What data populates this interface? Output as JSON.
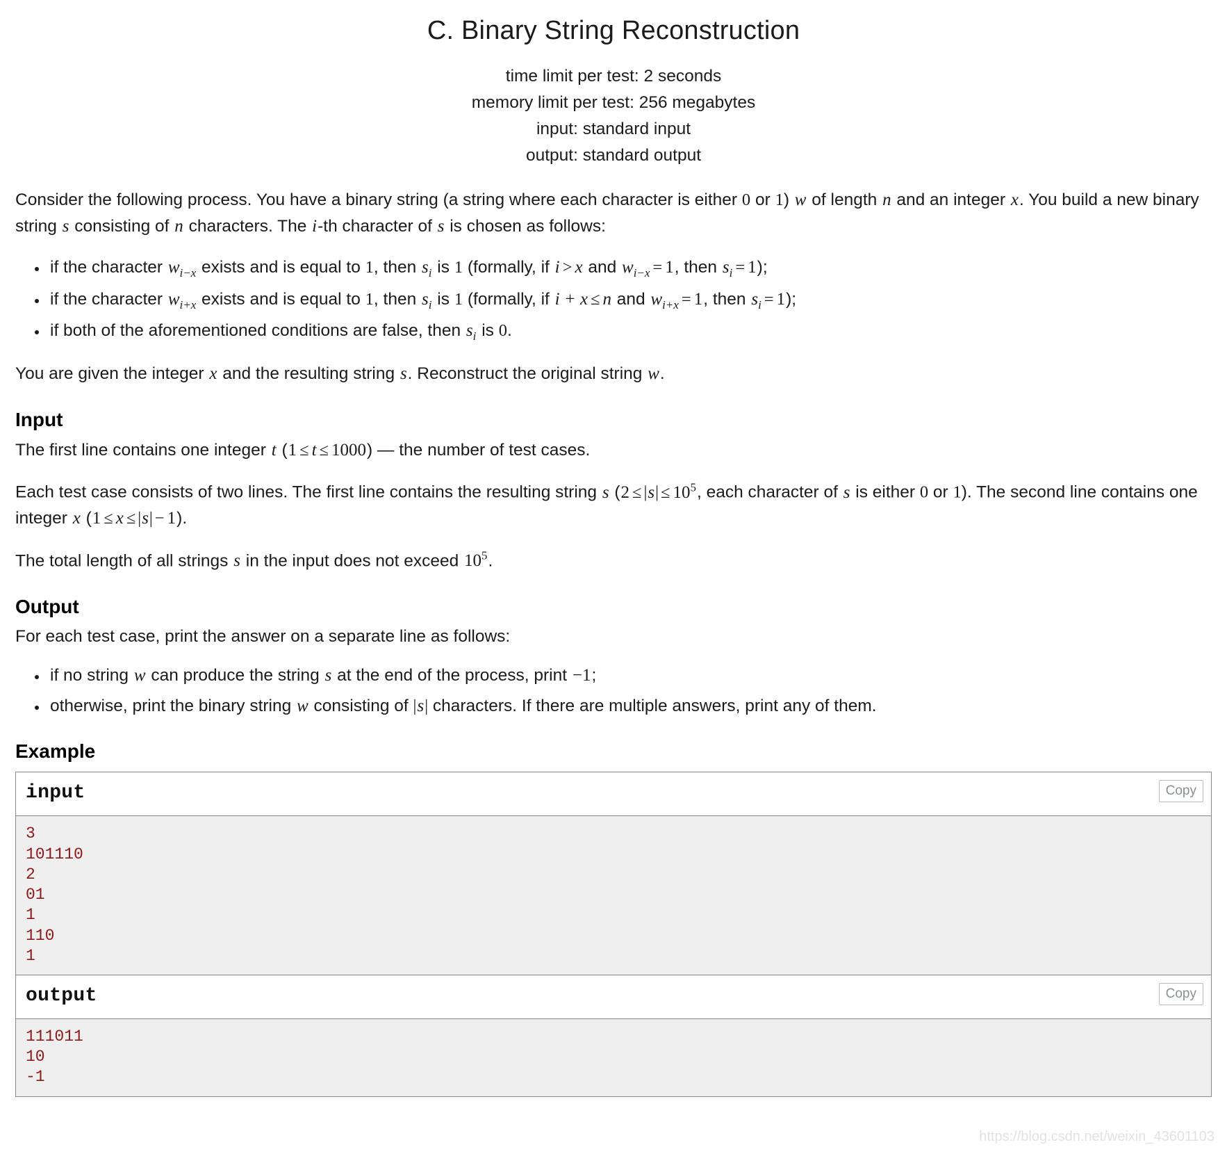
{
  "header": {
    "title": "C. Binary String Reconstruction",
    "time_limit": "time limit per test: 2 seconds",
    "memory_limit": "memory limit per test: 256 megabytes",
    "input_mode": "input: standard input",
    "output_mode": "output: standard output"
  },
  "statement": {
    "p1_a": "Consider the following process. You have a binary string (a string where each character is either ",
    "p1_zero": "0",
    "p1_or": " or ",
    "p1_one": "1",
    "p1_b": ") ",
    "p1_w": "w",
    "p1_c": " of length ",
    "p1_n": "n",
    "p1_d": " and an integer ",
    "p1_x": "x",
    "p1_e": ". You build a new binary string ",
    "p1_s": "s",
    "p1_f": " consisting of ",
    "p1_n2": "n",
    "p1_g": " characters. The ",
    "p1_i": "i",
    "p1_h": "-th character of ",
    "p1_s2": "s",
    "p1_j": " is chosen as follows:",
    "bullets": [
      {
        "a": "if the character ",
        "var": "w",
        "sub": "i−x",
        "b": " exists and is equal to ",
        "one1": "1",
        "c": ", then ",
        "svar": "s",
        "ssub": "i",
        "d": " is ",
        "one2": "1",
        "e": " (formally, if ",
        "cond_left": "i",
        "cond_op": ">",
        "cond_right": "x",
        "f": " and ",
        "var2": "w",
        "sub2": "i−x",
        "eq": "=",
        "one3": "1",
        "g": ", then ",
        "svar2": "s",
        "ssub2": "i",
        "eq2": "=",
        "one4": "1",
        "h": ");"
      },
      {
        "a": "if the character ",
        "var": "w",
        "sub": "i+x",
        "b": " exists and is equal to ",
        "one1": "1",
        "c": ", then ",
        "svar": "s",
        "ssub": "i",
        "d": " is ",
        "one2": "1",
        "e": " (formally, if ",
        "cond_left": "i + x",
        "cond_op": "≤",
        "cond_right": "n",
        "f": " and ",
        "var2": "w",
        "sub2": "i+x",
        "eq": "=",
        "one3": "1",
        "g": ", then ",
        "svar2": "s",
        "ssub2": "i",
        "eq2": "=",
        "one4": "1",
        "h": ");"
      }
    ],
    "bullet3_a": "if both of the aforementioned conditions are false, then ",
    "bullet3_s": "s",
    "bullet3_sub": "i",
    "bullet3_b": " is ",
    "bullet3_zero": "0",
    "bullet3_c": ".",
    "p2_a": "You are given the integer ",
    "p2_x": "x",
    "p2_b": " and the resulting string ",
    "p2_s": "s",
    "p2_c": ". Reconstruct the original string ",
    "p2_w": "w",
    "p2_d": "."
  },
  "input_section": {
    "heading": "Input",
    "l1_a": "The first line contains one integer ",
    "l1_t": "t",
    "l1_b": " (",
    "l1_one": "1",
    "l1_le1": "≤",
    "l1_t2": "t",
    "l1_le2": "≤",
    "l1_1000": "1000",
    "l1_c": ") — the number of test cases.",
    "l2_a": "Each test case consists of two lines. The first line contains the resulting string ",
    "l2_s": "s",
    "l2_b": " (",
    "l2_two": "2",
    "l2_le1": "≤",
    "l2_abs_s": "s",
    "l2_le2": "≤",
    "l2_pow_base": "10",
    "l2_pow_exp": "5",
    "l2_c": ", each character of ",
    "l2_s2": "s",
    "l2_d": " is either ",
    "l2_zero": "0",
    "l2_or": " or ",
    "l2_one": "1",
    "l2_e": "). The second line contains one integer ",
    "l2_x": "x",
    "l2_f": " (",
    "l2_one2": "1",
    "l2_le3": "≤",
    "l2_x2": "x",
    "l2_le4": "≤",
    "l2_abs_s2": "s",
    "l2_minus": "−",
    "l2_one3": "1",
    "l2_g": ").",
    "l3_a": "The total length of all strings ",
    "l3_s": "s",
    "l3_b": " in the input does not exceed ",
    "l3_pow_base": "10",
    "l3_pow_exp": "5",
    "l3_c": "."
  },
  "output_section": {
    "heading": "Output",
    "intro": "For each test case, print the answer on a separate line as follows:",
    "b1_a": "if no string ",
    "b1_w": "w",
    "b1_b": " can produce the string ",
    "b1_s": "s",
    "b1_c": " at the end of the process, print ",
    "b1_minus1": "−1",
    "b1_d": ";",
    "b2_a": "otherwise, print the binary string ",
    "b2_w": "w",
    "b2_b": " consisting of ",
    "b2_abs_s": "s",
    "b2_c": " characters. If there are multiple answers, print any of them."
  },
  "example": {
    "heading": "Example",
    "input_label": "input",
    "output_label": "output",
    "copy_label": "Copy",
    "input_data": "3\n101110\n2\n01\n1\n110\n1",
    "output_data": "111011\n10\n-1"
  },
  "watermark": "https://blog.csdn.net/weixin_43601103",
  "colors": {
    "sample_text": "#8b1a1a",
    "sample_bg": "#efefef",
    "border": "#888888",
    "copy_text": "#8a8f96"
  }
}
